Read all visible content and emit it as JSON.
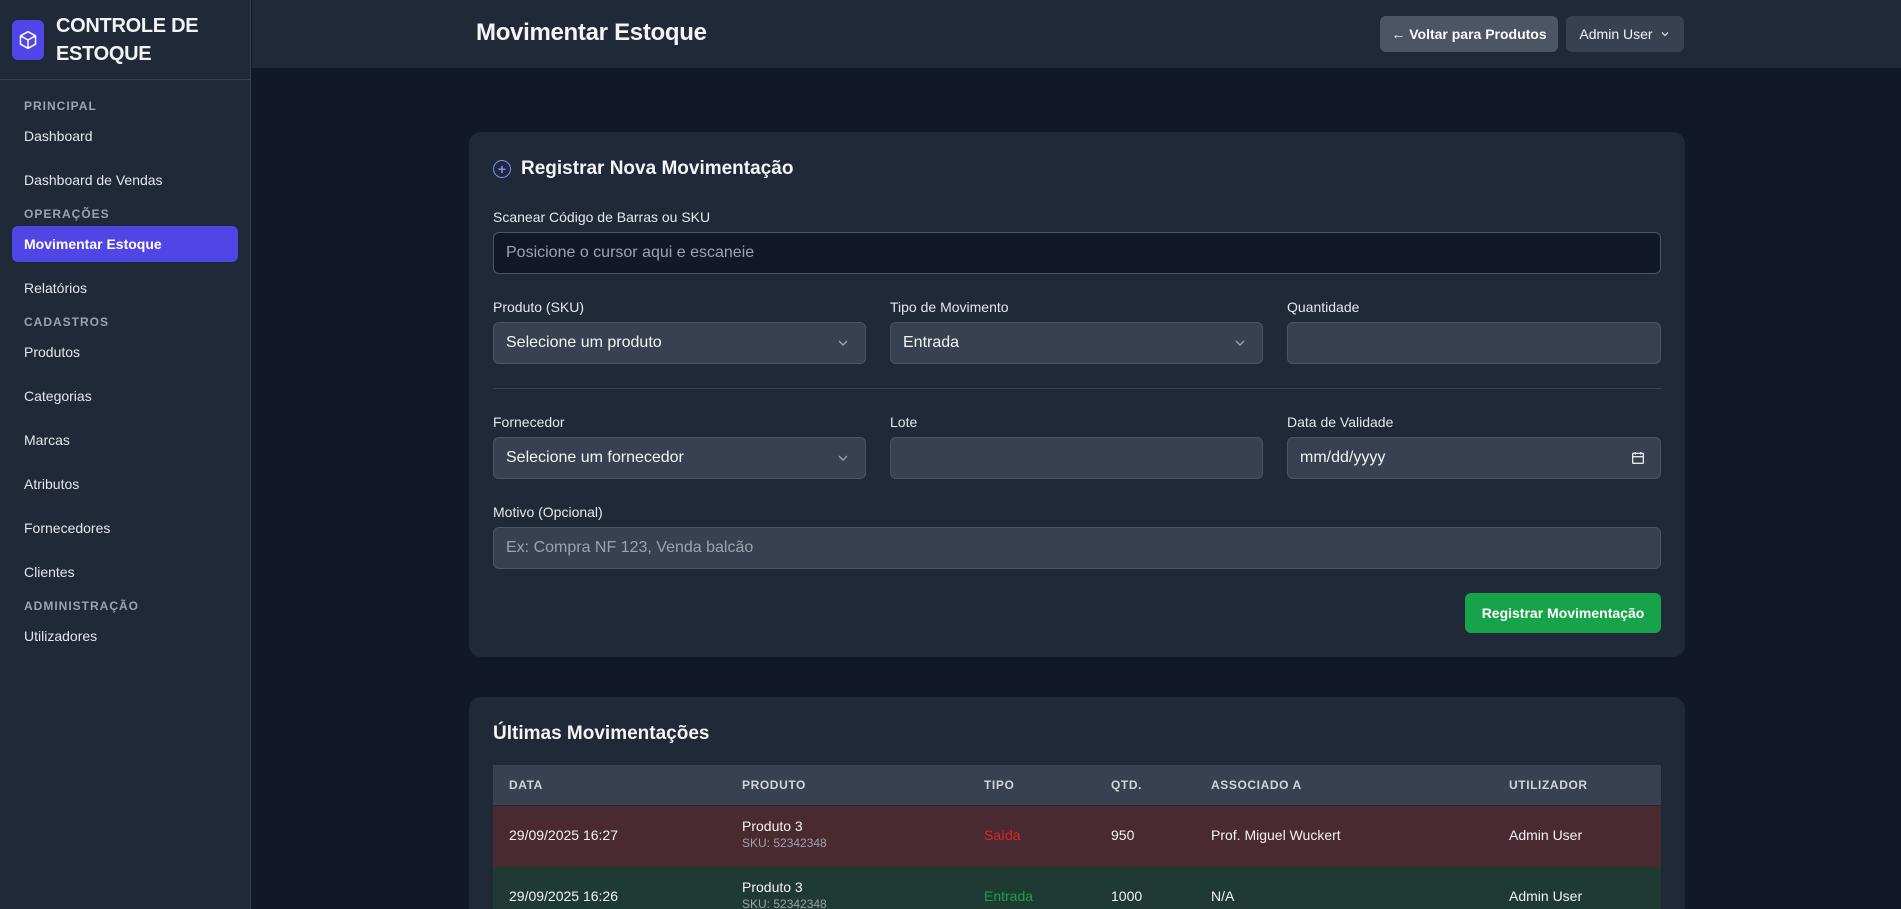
{
  "brand": {
    "title_line1": "CONTROLE DE",
    "title_line2": "ESTOQUE"
  },
  "sidebar": {
    "sections": [
      {
        "label": "PRINCIPAL",
        "items": [
          "Dashboard",
          "Dashboard de Vendas"
        ]
      },
      {
        "label": "OPERAÇÕES",
        "items": [
          "Movimentar Estoque",
          "Relatórios"
        ]
      },
      {
        "label": "CADASTROS",
        "items": [
          "Produtos",
          "Categorias",
          "Marcas",
          "Atributos",
          "Fornecedores",
          "Clientes"
        ]
      },
      {
        "label": "ADMINISTRAÇÃO",
        "items": [
          "Utilizadores"
        ]
      }
    ],
    "active_item": "Movimentar Estoque"
  },
  "header": {
    "title": "Movimentar Estoque",
    "back_label": "← Voltar para Produtos",
    "user_label": "Admin User"
  },
  "form": {
    "title": "Registrar Nova Movimentação",
    "scan_label": "Scanear Código de Barras ou SKU",
    "scan_placeholder": "Posicione o cursor aqui e escaneie",
    "produto_label": "Produto (SKU)",
    "produto_value": "Selecione um produto",
    "tipo_label": "Tipo de Movimento",
    "tipo_value": "Entrada",
    "quantidade_label": "Quantidade",
    "fornecedor_label": "Fornecedor",
    "fornecedor_value": "Selecione um fornecedor",
    "lote_label": "Lote",
    "validade_label": "Data de Validade",
    "validade_placeholder": "mm/dd/yyyy",
    "motivo_label": "Motivo (Opcional)",
    "motivo_placeholder": "Ex: Compra NF 123, Venda balcão",
    "submit_label": "Registrar Movimentação"
  },
  "movements": {
    "title": "Últimas Movimentações",
    "columns": [
      "DATA",
      "PRODUTO",
      "TIPO",
      "QTD.",
      "ASSOCIADO A",
      "UTILIZADOR"
    ],
    "rows": [
      {
        "data": "29/09/2025 16:27",
        "produto": "Produto 3",
        "sku": "SKU: 52342348",
        "tipo": "Saída",
        "qtd": "950",
        "associado": "Prof. Miguel Wuckert",
        "utilizador": "Admin User"
      },
      {
        "data": "29/09/2025 16:26",
        "produto": "Produto 3",
        "sku": "SKU: 52342348",
        "tipo": "Entrada",
        "qtd": "1000",
        "associado": "N/A",
        "utilizador": "Admin User"
      }
    ]
  },
  "colors": {
    "accent": "#4f46e5",
    "success": "#16a34a",
    "danger": "#dc2626"
  }
}
